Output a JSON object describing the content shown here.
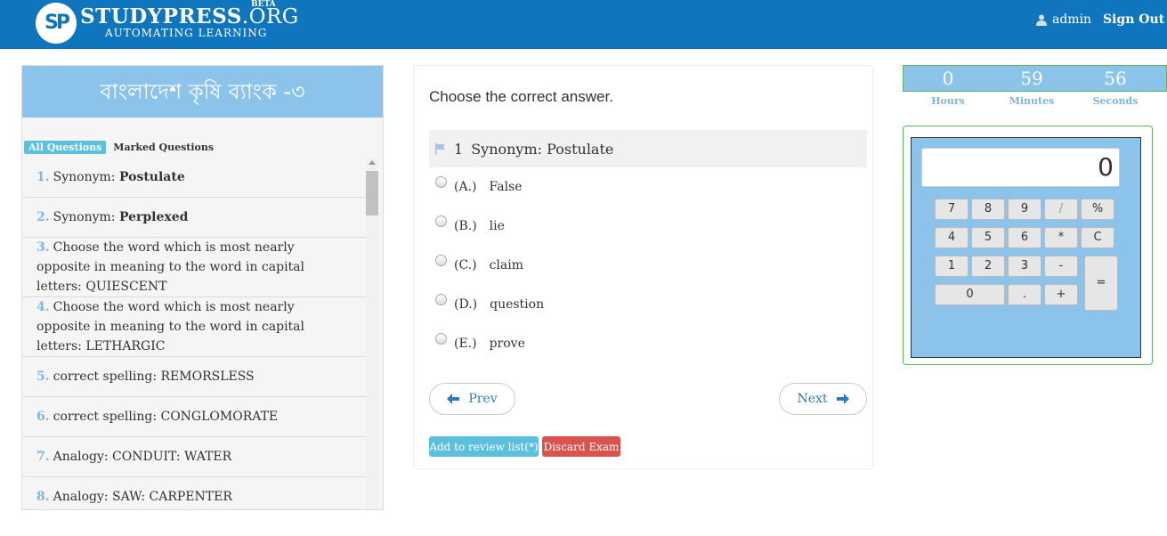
{
  "header": {
    "logo_mark": "SP",
    "logo_name": "STUDYPRESS",
    "logo_org": ".ORG",
    "logo_beta": "BETA",
    "logo_tagline": "AUTOMATING LEARNING",
    "username": "admin",
    "signout_label": "Sign Out"
  },
  "exam": {
    "title": "বাংলাদেশ কৃষি ব্যাংক -৩",
    "tab_all": "All Questions",
    "tab_marked": "Marked Questions",
    "questions": [
      {
        "num": "1.",
        "text": "Synonym: ",
        "bold": "Postulate"
      },
      {
        "num": "2.",
        "text": "Synonym: ",
        "bold": "Perplexed"
      },
      {
        "num": "3.",
        "text": "Choose the word which is most nearly opposite in meaning to the word in capital letters: QUIESCENT",
        "bold": ""
      },
      {
        "num": "4.",
        "text": "Choose the word which is most nearly opposite in meaning to the word in capital letters: LETHARGIC",
        "bold": ""
      },
      {
        "num": "5.",
        "text": "correct spelling: REMORSLESS",
        "bold": ""
      },
      {
        "num": "6.",
        "text": "correct spelling: CONGLOMORATE",
        "bold": ""
      },
      {
        "num": "7.",
        "text": "Analogy: CONDUIT: WATER",
        "bold": ""
      },
      {
        "num": "8.",
        "text": "Analogy: SAW: CARPENTER",
        "bold": ""
      }
    ]
  },
  "question_card": {
    "instruction": "Choose the correct answer.",
    "number": "1",
    "question": "Synonym: Postulate",
    "options": [
      {
        "label": "(A.)",
        "text": "False"
      },
      {
        "label": "(B.)",
        "text": "lie"
      },
      {
        "label": "(C.)",
        "text": "claim"
      },
      {
        "label": "(D.)",
        "text": "question"
      },
      {
        "label": "(E.)",
        "text": "prove"
      }
    ],
    "prev_label": "Prev",
    "next_label": "Next",
    "review_label": "Add to review list(*)",
    "discard_label": "Discard Exam",
    "review_color": "#5bc0de",
    "discard_color": "#d9534f"
  },
  "timer": {
    "hours": "0",
    "minutes": "59",
    "seconds": "56",
    "hours_label": "Hours",
    "minutes_label": "Minutes",
    "seconds_label": "Seconds"
  },
  "calculator": {
    "display": "0",
    "keys": [
      "7",
      "8",
      "9",
      "/",
      "%",
      "4",
      "5",
      "6",
      "*",
      "C",
      "1",
      "2",
      "3",
      "-",
      "0",
      ".",
      "+",
      "="
    ]
  },
  "colors": {
    "header_bg": "#0f75bd",
    "panel_accent": "#8bc3ea",
    "link": "#337ab7"
  }
}
